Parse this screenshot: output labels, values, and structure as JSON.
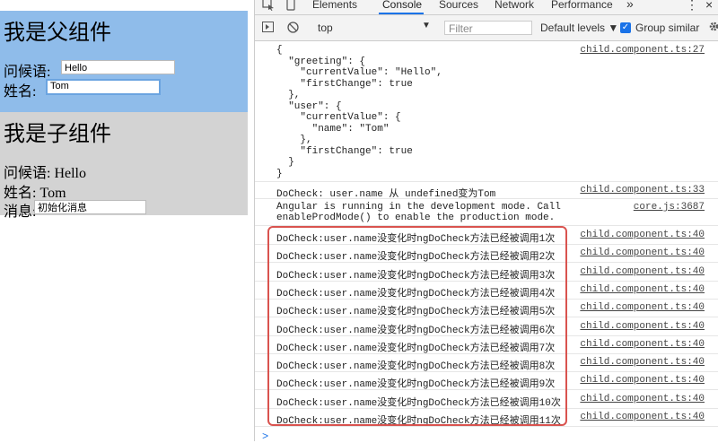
{
  "app": {
    "parent": {
      "title": "我是父组件",
      "greeting_label": "问候语:",
      "greeting_value": "Hello",
      "name_label": "姓名:",
      "name_value": "Tom"
    },
    "child": {
      "title": "我是子组件",
      "greeting_line": "问候语: Hello",
      "name_line": "姓名: Tom",
      "message_label": "消息:",
      "message_value": "初始化消息"
    }
  },
  "devtools": {
    "tabs": [
      "Elements",
      "Console",
      "Sources",
      "Network",
      "Performance"
    ],
    "more_tabs": "»",
    "menu": "⋮",
    "close": "×",
    "context": "top",
    "filter_placeholder": "Filter",
    "levels": "Default levels ▼",
    "group_similar": "Group similar",
    "checkbox_mark": "✓",
    "settings_icon": "gear-icon"
  },
  "console": {
    "object_log": {
      "source": "child.component.ts:27",
      "lines": [
        "{",
        "  \"greeting\": {",
        "    \"currentValue\": \"Hello\",",
        "    \"firstChange\": true",
        "  },",
        "  \"user\": {",
        "    \"currentValue\": {",
        "      \"name\": \"Tom\"",
        "    },",
        "    \"firstChange\": true",
        "  }",
        "}"
      ]
    },
    "docheck_log": {
      "text": "DoCheck: user.name 从 undefined变为Tom",
      "source": "child.component.ts:33"
    },
    "angular_log": {
      "text": "Angular is running in the development mode. Call\nenableProdMode() to enable the production mode.",
      "source": "core.js:3687"
    },
    "repeat_logs": [
      {
        "text": "DoCheck:user.name没变化时ngDoCheck方法已经被调用1次",
        "source": "child.component.ts:40"
      },
      {
        "text": "DoCheck:user.name没变化时ngDoCheck方法已经被调用2次",
        "source": "child.component.ts:40"
      },
      {
        "text": "DoCheck:user.name没变化时ngDoCheck方法已经被调用3次",
        "source": "child.component.ts:40"
      },
      {
        "text": "DoCheck:user.name没变化时ngDoCheck方法已经被调用4次",
        "source": "child.component.ts:40"
      },
      {
        "text": "DoCheck:user.name没变化时ngDoCheck方法已经被调用5次",
        "source": "child.component.ts:40"
      },
      {
        "text": "DoCheck:user.name没变化时ngDoCheck方法已经被调用6次",
        "source": "child.component.ts:40"
      },
      {
        "text": "DoCheck:user.name没变化时ngDoCheck方法已经被调用7次",
        "source": "child.component.ts:40"
      },
      {
        "text": "DoCheck:user.name没变化时ngDoCheck方法已经被调用8次",
        "source": "child.component.ts:40"
      },
      {
        "text": "DoCheck:user.name没变化时ngDoCheck方法已经被调用9次",
        "source": "child.component.ts:40"
      },
      {
        "text": "DoCheck:user.name没变化时ngDoCheck方法已经被调用10次",
        "source": "child.component.ts:40"
      },
      {
        "text": "DoCheck:user.name没变化时ngDoCheck方法已经被调用11次",
        "source": "child.component.ts:40"
      }
    ],
    "prompt": ">",
    "highlight_color": "#d9534f"
  }
}
